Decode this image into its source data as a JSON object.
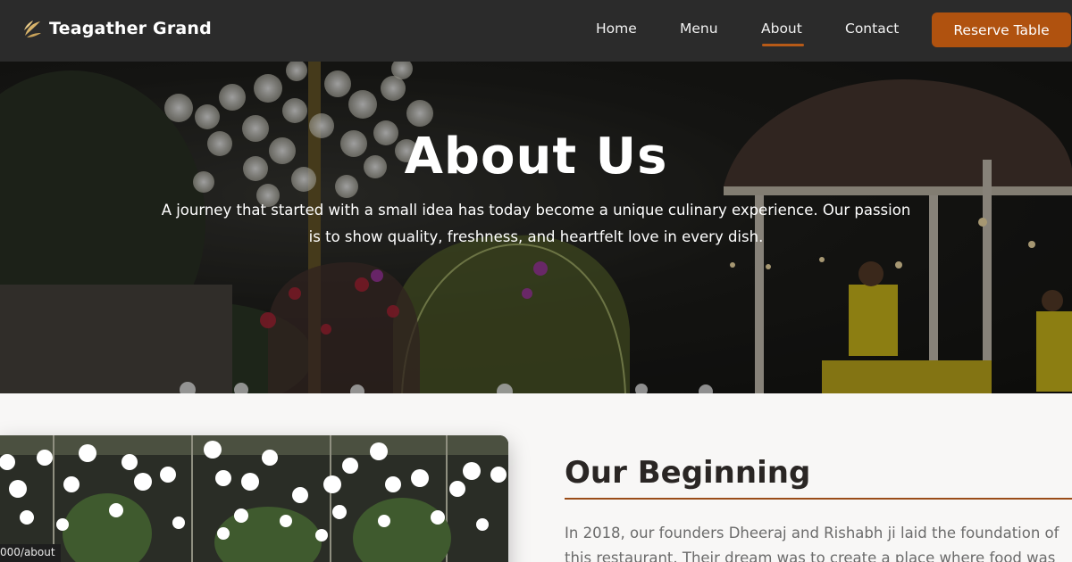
{
  "brand": {
    "name": "Teagather Grand",
    "logo_icon": "leaf-icon",
    "accent": "#b0520f"
  },
  "nav": {
    "items": [
      {
        "label": "Home"
      },
      {
        "label": "Menu"
      },
      {
        "label": "About",
        "active": true
      },
      {
        "label": "Contact"
      }
    ],
    "reserve_label": "Reserve Table"
  },
  "hero": {
    "title": "About Us",
    "subtitle": "A journey that started with a small idea has today become a unique culinary experience. Our passion is to show quality, freshness, and heartfelt love in every dish."
  },
  "story": {
    "heading": "Our Beginning",
    "line1": "In 2018, our founders Dheeraj and Rishabh ji laid the foundation of",
    "line2": "this restaurant. Their dream was to create a place where food was"
  },
  "status_bar": {
    "url": "000/about"
  }
}
